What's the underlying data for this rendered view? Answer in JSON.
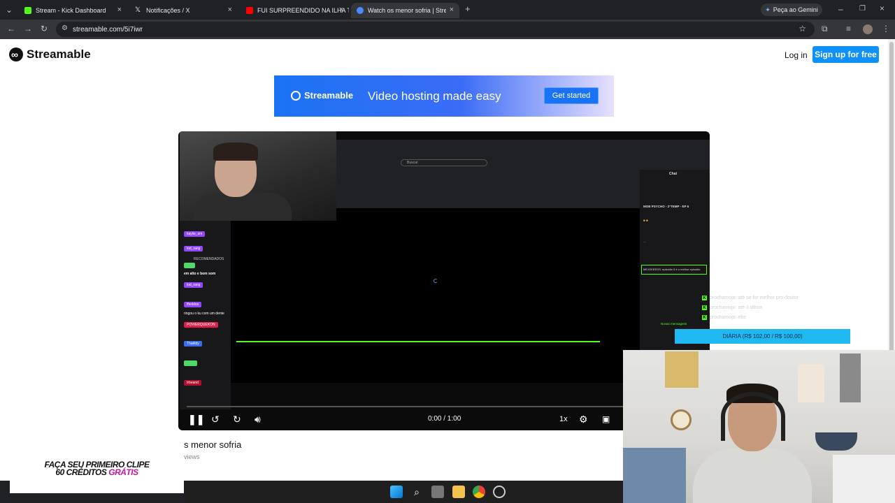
{
  "browser": {
    "tabs": [
      {
        "title": "Stream - Kick Dashboard",
        "favicon_color": "#53fc18",
        "active": false
      },
      {
        "title": "Notificações / X",
        "favicon_color": "#e8eaed",
        "active": false
      },
      {
        "title": "FUI SURPREENDIDO NA ILHA T",
        "favicon_color": "#ff0000",
        "active": false
      },
      {
        "title": "Watch os menor sofria | Stream",
        "favicon_color": "#4a8cff",
        "active": true
      }
    ],
    "gemini_label": "Peça ao Gemini",
    "url": "streamable.com/5i7iwr"
  },
  "header": {
    "logo_text": "Streamable",
    "login_label": "Log in",
    "signup_label": "Sign up for free"
  },
  "banner": {
    "brand": "Streamable",
    "tagline": "Video hosting made easy",
    "cta_label": "Get started"
  },
  "player": {
    "time": "0:00 / 1:00",
    "speed": "1x",
    "progress": 0.0,
    "inner_search_placeholder": "Buscar",
    "inner_chat_title": "Chat",
    "inner_left_items": [
      "RECOMENDADOS",
      "em alto e bom som",
      "ringou o ku com um dente"
    ],
    "inner_chat_lines": [
      "MOB PSYCHO - 2°TEMP - EP 6",
      "MEJOKEEGS: episódio 5 é o melhor episódio",
      "Novas mensagens"
    ]
  },
  "video": {
    "title": "s menor sofria",
    "views": "views"
  },
  "overlay": {
    "promo_line1": "FAÇA SEU PRIMEIRO CLIPE",
    "promo_line2_prefix": "60 CRÉDITOS ",
    "promo_line2_highlight": "GRÁTIS",
    "chat": [
      "prochamojo: até se for melhor pro doutor",
      "prochamojo: até ó diboa",
      "prochamojo: ebs"
    ],
    "diaria_label": "DIÁRIA (R$ 102,00 / R$ 100,00)"
  },
  "colors": {
    "brand_blue": "#0f90fa",
    "kick_green": "#53fc18",
    "diaria_bg": "#1fb8f0",
    "promo_pink": "#c0189b"
  }
}
